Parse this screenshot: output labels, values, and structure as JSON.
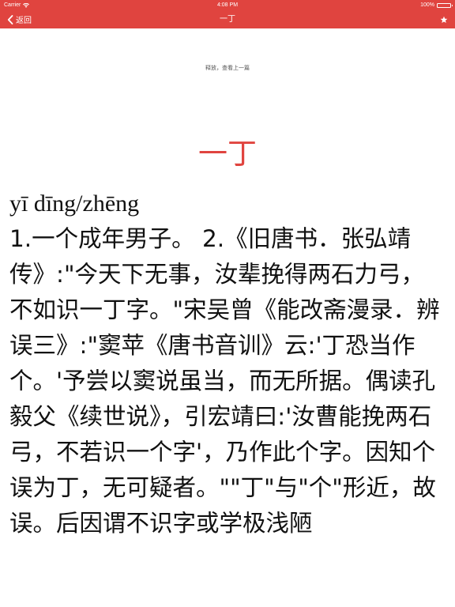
{
  "status_bar": {
    "carrier": "Carrier",
    "time": "4:08 PM",
    "battery": "100%",
    "battery_level": 1.0
  },
  "nav_bar": {
    "back_label": "返回",
    "title": "一丁",
    "back_icon": "chevron-left-icon",
    "favorite_icon": "star-icon"
  },
  "content": {
    "pull_hint": "释放，查看上一篇",
    "title": "一丁",
    "pinyin": "yī dīng/zhēng",
    "definition": "1.一个成年男子。 2.《旧唐书．张弘靖传》:\"今天下无事，汝辈挽得两石力弓，不如识一丁字。\"宋吴曾《能改斋漫录．辨误三》:\"窦苹《唐书音训》云:'丁恐当作个。'予尝以窦说虽当，而无所据。偶读孔毅父《续世说》，引宏靖曰:'汝曹能挽两石弓，不若识一个字'，乃作此个字。因知个误为丁，无可疑者。\"\"丁\"与\"个\"形近，故误。后因谓不识字或学极浅陋"
  },
  "colors": {
    "brand": "#e0443f",
    "text": "#111111",
    "background": "#ffffff"
  }
}
